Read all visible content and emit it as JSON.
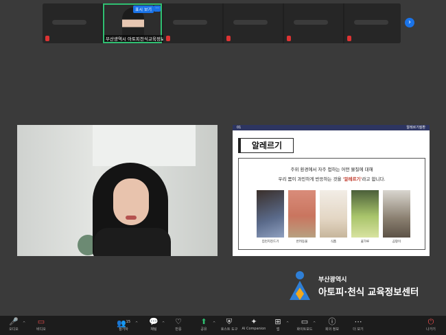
{
  "strip": {
    "active_name": "부산광역시 아토피천식교육정보...",
    "active_badge": "표시 보기",
    "active_more": "···",
    "next_icon": "chevron-right-icon"
  },
  "slide": {
    "page_num": "01",
    "section": "알레르기질환",
    "title": "알레르기",
    "line1": "주위 환경에서 자주 접하는 어떤 물질에 대해",
    "line2_pre": "우리 몸이 과민하게 반응하는 것을 ",
    "line2_hl": "'알레르기'",
    "line2_post": "라고 합니다.",
    "captions": [
      "집먼지진드기",
      "반려동물",
      "식품",
      "꽃가루",
      "곰팡이"
    ]
  },
  "logo": {
    "sub": "부산광역시",
    "main": "아토피·천식 교육정보센터"
  },
  "toolbar": {
    "audio": "오디오",
    "video": "비디오",
    "participants": "참가자",
    "participants_count": "15",
    "chat": "채팅",
    "react": "반응",
    "share": "공유",
    "host_tools": "호스트 도구",
    "ai": "AI Companion",
    "apps": "앱",
    "whiteboard": "화이트보드",
    "info": "회의 정보",
    "more": "더 보기",
    "leave": "나가기"
  }
}
